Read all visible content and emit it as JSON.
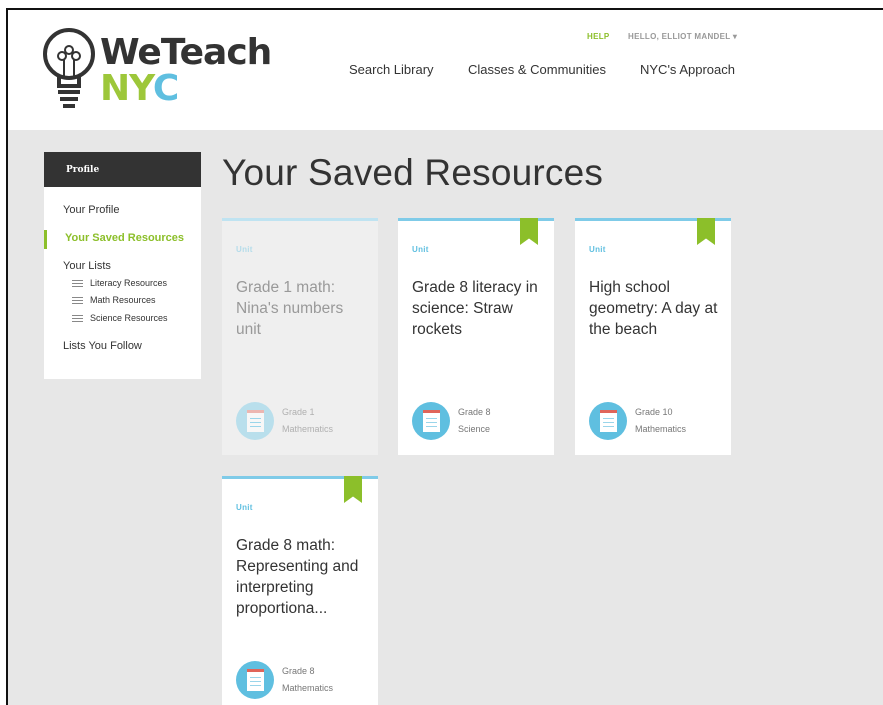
{
  "header": {
    "logo_line1": "WeTeach",
    "logo_line2_a": "NY",
    "logo_line2_b": "C",
    "help": "HELP",
    "user_menu": "HELLO, ELLIOT MANDEL ▾",
    "nav": [
      "Search Library",
      "Classes & Communities",
      "NYC's Approach"
    ]
  },
  "sidebar": {
    "heading": "Profile",
    "your_profile": "Your Profile",
    "saved_resources": "Your Saved Resources",
    "your_lists": "Your Lists",
    "lists": [
      "Literacy Resources",
      "Math Resources",
      "Science Resources"
    ],
    "lists_you_follow": "Lists You Follow"
  },
  "main": {
    "title": "Your Saved Resources",
    "cards": [
      {
        "type": "Unit",
        "title": "Grade 1 math: Nina's numbers unit",
        "grade": "Grade 1",
        "subject": "Mathematics",
        "saved": false
      },
      {
        "type": "Unit",
        "title": "Grade 8 literacy in science: Straw rockets",
        "grade": "Grade 8",
        "subject": "Science",
        "saved": true
      },
      {
        "type": "Unit",
        "title": "High school geometry: A day at the beach",
        "grade": "Grade 10",
        "subject": "Mathematics",
        "saved": true
      },
      {
        "type": "Unit",
        "title": "Grade 8 math: Representing and interpreting proportiona...",
        "grade": "Grade 8",
        "subject": "Mathematics",
        "saved": true
      }
    ]
  },
  "colors": {
    "accent_green": "#8cbf2a",
    "accent_blue": "#5fbfe0",
    "dark": "#333333",
    "page_bg": "#e7e7e7"
  },
  "icons": [
    "lightbulb-logo-icon",
    "list-icon",
    "bookmark-icon",
    "resource-doc-icon",
    "chevron-down-icon"
  ]
}
